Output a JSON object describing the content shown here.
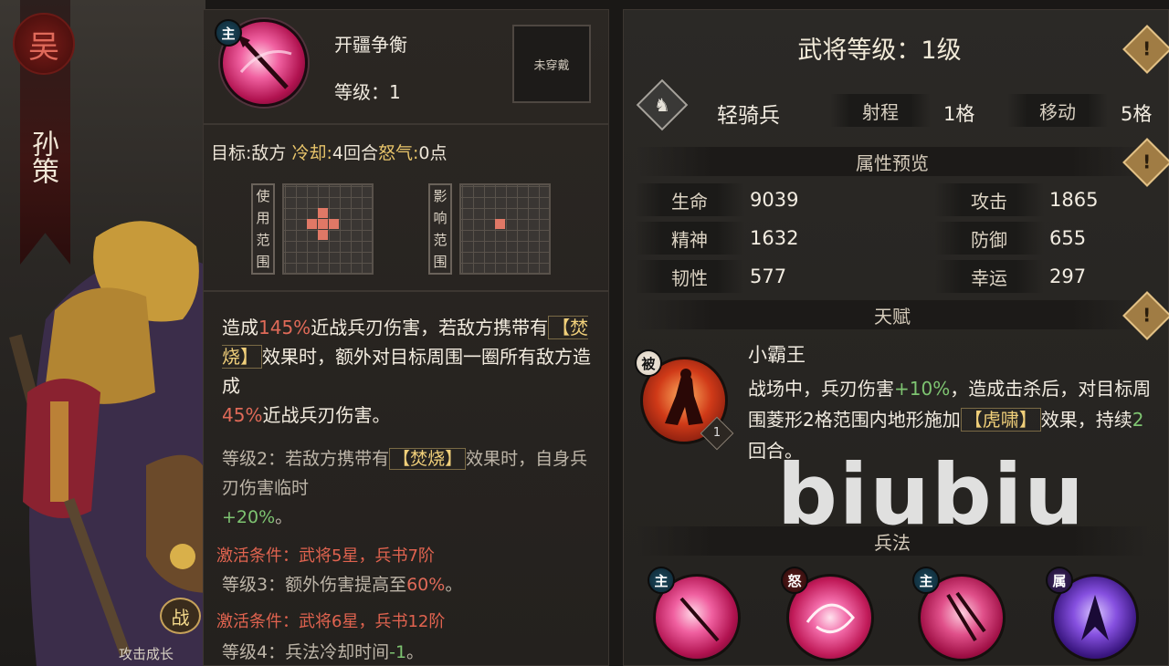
{
  "hero": {
    "kingdom": "吴",
    "name": "孙策",
    "badge": "战",
    "caption": "攻击成长"
  },
  "skill": {
    "tag": "主",
    "name": "开疆争衡",
    "level_text": "等级：1",
    "equip_status": "未穿戴",
    "target_label": "目标:",
    "target_value": "敌方",
    "cooldown_label": "冷却:",
    "cooldown_value": "4回合",
    "rage_label": "怒气:",
    "rage_value": "0点",
    "use_range_label": "使用范围",
    "affect_range_label": "影响范围",
    "description": {
      "part1": "造成",
      "pct1": "145%",
      "part2": "近战兵刃伤害，若敌方携带有",
      "status1": "【焚烧】",
      "part3": "效果时，额外对目标周围一圈所有敌方造成",
      "pct2": "45%",
      "part4": "近战兵刃伤害。"
    },
    "level2": {
      "prefix": "等级2：若敌方携带有",
      "status": "【焚烧】",
      "mid": "效果时，自身兵刃伤害临时",
      "bonus": "+20%",
      "suffix": "。"
    },
    "cond1": "激活条件：武将5星，兵书7阶",
    "level3": {
      "prefix": "等级3：额外伤害提高至",
      "value": "60%",
      "suffix": "。"
    },
    "cond2": "激活条件：武将6星，兵书12阶",
    "level4": {
      "prefix": "等级4：兵法冷却时间",
      "value": "-1",
      "suffix": "。"
    }
  },
  "stats": {
    "title": "武将等级：1级",
    "troop_type": "轻骑兵",
    "range_label": "射程",
    "range_value": "1格",
    "move_label": "移动",
    "move_value": "5格",
    "attr_header": "属性预览",
    "attributes": [
      {
        "name": "生命",
        "value": "9039"
      },
      {
        "name": "攻击",
        "value": "1865"
      },
      {
        "name": "精神",
        "value": "1632"
      },
      {
        "name": "防御",
        "value": "655"
      },
      {
        "name": "韧性",
        "value": "577"
      },
      {
        "name": "幸运",
        "value": "297"
      }
    ],
    "talent_header": "天赋",
    "talent": {
      "tag": "被",
      "level": "1",
      "name": "小霸王",
      "desc1": "战场中，兵刃伤害",
      "desc_bonus": "+10%",
      "desc2": "，造成击杀后，对目标周围菱形2格范围内地形施加",
      "desc_status": "【虎啸】",
      "desc3": "效果，持续",
      "desc_turns": "2",
      "desc4": "回合。"
    },
    "tactics_header": "兵法",
    "tactics": [
      {
        "tag": "主",
        "icon": "crimson-spear-icon"
      },
      {
        "tag": "怒",
        "icon": "crimson-swirl-icon"
      },
      {
        "tag": "主",
        "icon": "crimson-strike-icon"
      },
      {
        "tag": "属",
        "icon": "violet-shard-icon"
      }
    ],
    "warn_glyph": "!"
  },
  "watermark": "biubiu"
}
